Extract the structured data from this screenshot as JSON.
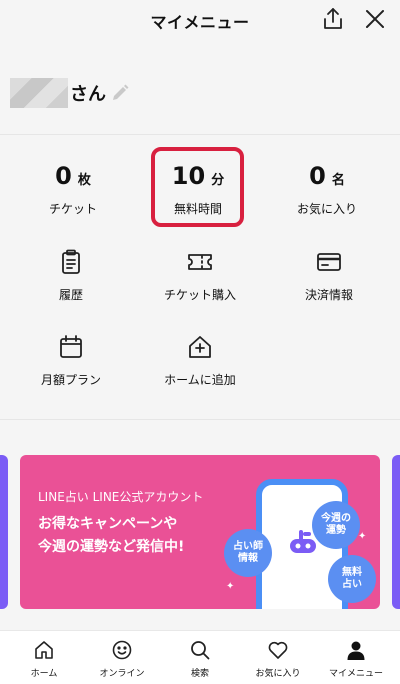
{
  "header": {
    "title": "マイメニュー"
  },
  "user": {
    "suffix": "さん"
  },
  "stats": [
    {
      "value": "0",
      "unit": "枚",
      "label": "チケット"
    },
    {
      "value": "10",
      "unit": "分",
      "label": "無料時間"
    },
    {
      "value": "0",
      "unit": "名",
      "label": "お気に入り"
    }
  ],
  "menu": [
    {
      "label": "履歴",
      "icon": "clipboard-icon"
    },
    {
      "label": "チケット購入",
      "icon": "ticket-icon"
    },
    {
      "label": "決済情報",
      "icon": "credit-card-icon"
    },
    {
      "label": "月額プラン",
      "icon": "calendar-icon"
    },
    {
      "label": "ホームに追加",
      "icon": "home-add-icon"
    }
  ],
  "banner": {
    "subtitle": "LINE占い LINE公式アカウント",
    "line1": "お得なキャンペーンや",
    "line2": "今週の運勢など発信中!",
    "bubbles": [
      "今週の\n運勢",
      "占い師\n情報",
      "無料\n占い"
    ],
    "color": "#ea5196"
  },
  "nav": [
    {
      "label": "ホーム",
      "icon": "home-icon"
    },
    {
      "label": "オンライン",
      "icon": "smile-icon"
    },
    {
      "label": "検索",
      "icon": "search-icon"
    },
    {
      "label": "お気に入り",
      "icon": "heart-icon"
    },
    {
      "label": "マイメニュー",
      "icon": "person-icon"
    }
  ],
  "colors": {
    "highlight": "#d8203f",
    "accent": "#7b5cf5",
    "bubble": "#5b8ff2"
  }
}
